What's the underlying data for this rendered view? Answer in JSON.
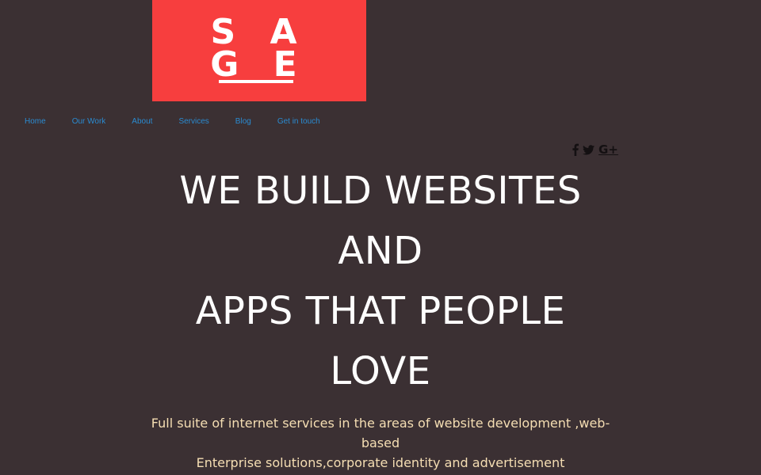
{
  "logo": {
    "line1": "S A",
    "line2": "G E",
    "background": "#f73e3e"
  },
  "nav": {
    "items": [
      "Home",
      "Our Work",
      "About",
      "Services",
      "Blog",
      "Get in touch"
    ],
    "link_color": "#2a8bd1"
  },
  "social": {
    "icons": [
      "facebook-icon",
      "twitter-icon",
      "google-plus-icon"
    ],
    "gplus_label": "G+"
  },
  "hero": {
    "line1": "WE BUILD WEBSITES",
    "line2": "AND",
    "line3": "APPS THAT PEOPLE",
    "line4": "LOVE",
    "color": "#ffffff"
  },
  "subtitle": {
    "line1": "Full suite of internet services in the areas of website development ,web-",
    "line2": "based",
    "line3": "Enterprise solutions,corporate identity and advertisement",
    "color": "#f5deb3"
  },
  "page": {
    "background": "#3b3033"
  }
}
